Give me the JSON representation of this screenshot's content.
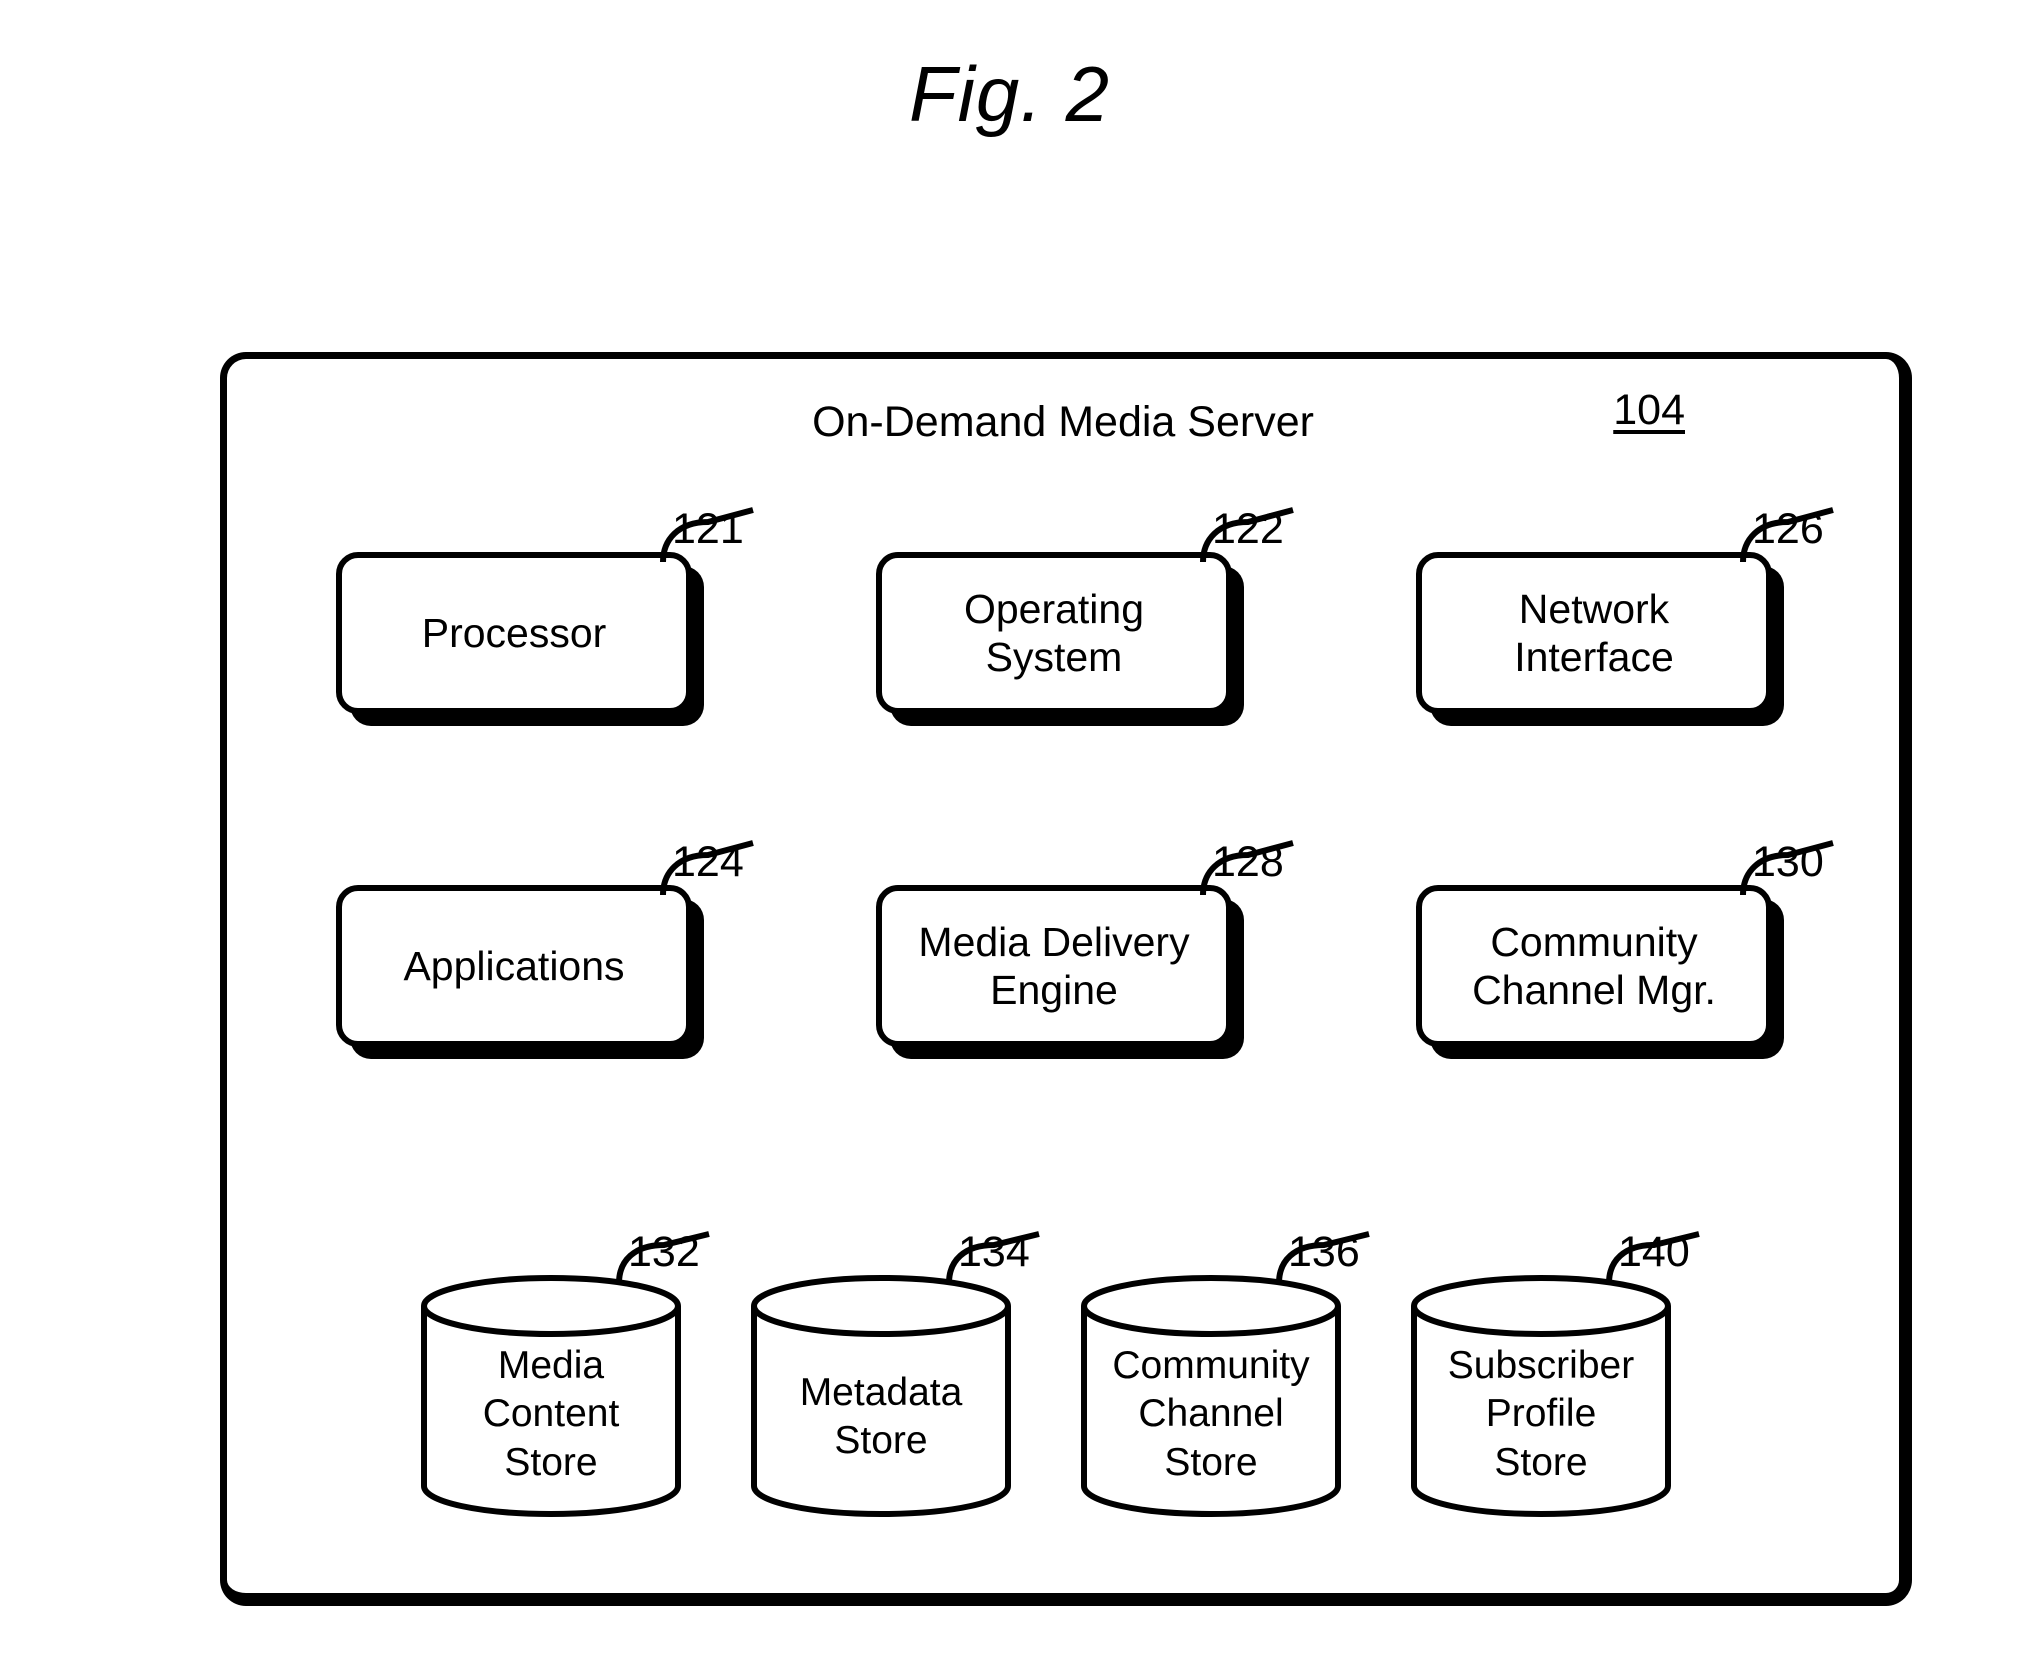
{
  "figure": {
    "title": "Fig. 2"
  },
  "server": {
    "title": "On-Demand Media Server",
    "ref": "104"
  },
  "components": [
    {
      "id": "processor",
      "label": "Processor",
      "ref": "121"
    },
    {
      "id": "operating-system",
      "label": "Operating\nSystem",
      "ref": "122"
    },
    {
      "id": "network-interface",
      "label": "Network\nInterface",
      "ref": "126"
    },
    {
      "id": "applications",
      "label": "Applications",
      "ref": "124"
    },
    {
      "id": "media-delivery-engine",
      "label": "Media Delivery\nEngine",
      "ref": "128"
    },
    {
      "id": "community-channel-mgr",
      "label": "Community\nChannel Mgr.",
      "ref": "130"
    }
  ],
  "datastores": [
    {
      "id": "media-content-store",
      "label": "Media\nContent\nStore",
      "ref": "132"
    },
    {
      "id": "metadata-store",
      "label": "Metadata\nStore",
      "ref": "134"
    },
    {
      "id": "community-channel-store",
      "label": "Community\nChannel\nStore",
      "ref": "136"
    },
    {
      "id": "subscriber-profile-store",
      "label": "Subscriber\nProfile\nStore",
      "ref": "140"
    }
  ],
  "colors": {
    "line": "#000000",
    "background": "#ffffff"
  }
}
